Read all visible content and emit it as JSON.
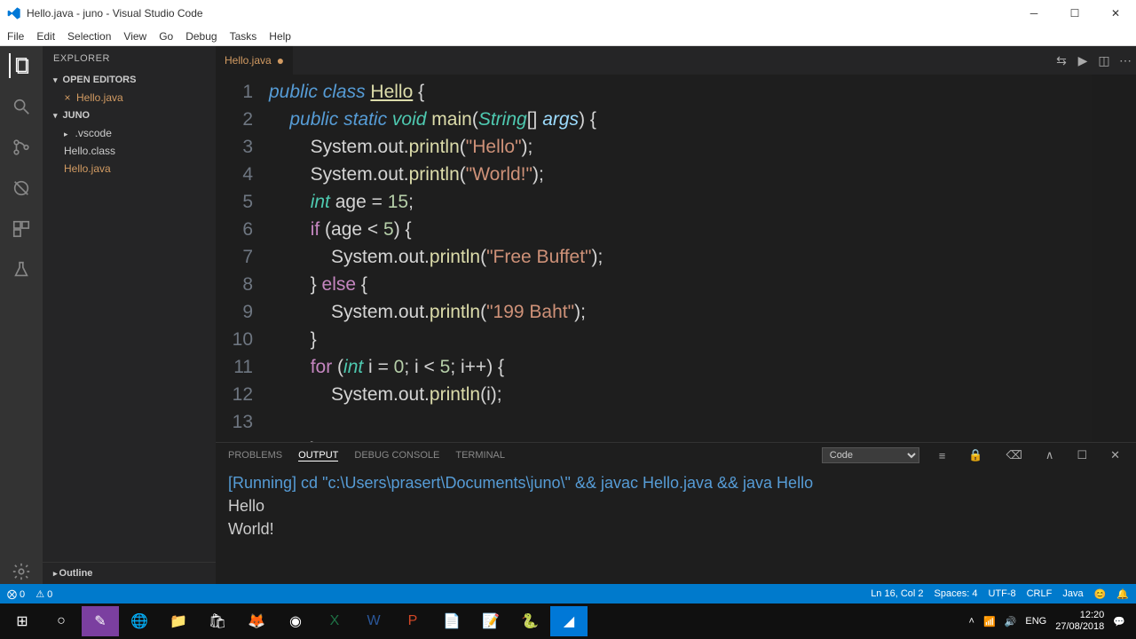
{
  "window": {
    "title": "Hello.java - juno - Visual Studio Code"
  },
  "menu": [
    "File",
    "Edit",
    "Selection",
    "View",
    "Go",
    "Debug",
    "Tasks",
    "Help"
  ],
  "sidebar": {
    "title": "Explorer",
    "openEditors": "Open Editors",
    "openEditorsItems": [
      "Hello.java"
    ],
    "project": "juno",
    "files": [
      {
        "name": ".vscode",
        "folder": true
      },
      {
        "name": "Hello.class",
        "folder": false
      },
      {
        "name": "Hello.java",
        "folder": false,
        "modified": true
      }
    ],
    "outline": "Outline"
  },
  "tab": {
    "name": "Hello.java"
  },
  "codeLines": [
    "<span class='kw-access'>public</span> <span class='kw-access'>class</span> <span class='cls'>Hello</span> {",
    "    <span class='kw-access'>public</span> <span class='kw-access'>static</span> <span class='type'>void</span> <span class='fn'>main</span>(<span class='type'>String</span>[] <span class='var'>args</span>) {",
    "        System.out.<span class='fn'>println</span>(<span class='str'>\"Hello\"</span>);",
    "        System.out.<span class='fn'>println</span>(<span class='str'>\"World!\"</span>);",
    "        <span class='type'>int</span> age <span class='op'>=</span> <span class='num'>15</span>;",
    "        <span class='kw'>if</span> (age <span class='op'>&lt;</span> <span class='num'>5</span>) {",
    "            System.out.<span class='fn'>println</span>(<span class='str'>\"Free Buffet\"</span>);",
    "        } <span class='kw'>else</span> {",
    "            System.out.<span class='fn'>println</span>(<span class='str'>\"199 Baht\"</span>);",
    "        }",
    "        <span class='kw'>for</span> (<span class='type'>int</span> i <span class='op'>=</span> <span class='num'>0</span>; i <span class='op'>&lt;</span> <span class='num'>5</span>; i<span class='op'>++</span>) {",
    "            System.out.<span class='fn'>println</span>(i);",
    "",
    "        }"
  ],
  "panel": {
    "tabs": [
      "PROBLEMS",
      "OUTPUT",
      "DEBUG CONSOLE",
      "TERMINAL"
    ],
    "active": 1,
    "selector": "Code",
    "lines": [
      {
        "cls": "run",
        "text": "[Running] cd \"c:\\Users\\prasert\\Documents\\juno\\\" && javac Hello.java && java Hello"
      },
      {
        "cls": "",
        "text": "Hello"
      },
      {
        "cls": "",
        "text": "World!"
      }
    ]
  },
  "status": {
    "left": [
      "⨂ 0",
      "⚠ 0"
    ],
    "right": [
      "Ln 16, Col 2",
      "Spaces: 4",
      "UTF-8",
      "CRLF",
      "Java",
      "😊",
      "🔔"
    ]
  },
  "tray": {
    "lang": "ENG",
    "time": "12:20",
    "date": "27/08/2018"
  }
}
